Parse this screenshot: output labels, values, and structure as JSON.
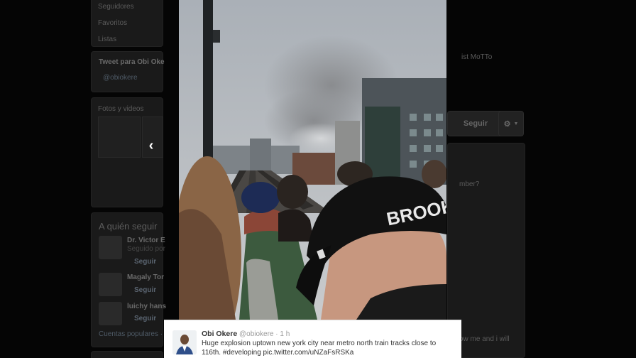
{
  "sidebar_nav": {
    "items": [
      "Seguidores",
      "Favoritos",
      "Listas"
    ]
  },
  "tweet_to": {
    "title": "Tweet para Obi Oke",
    "placeholder": "@obiokere"
  },
  "media": {
    "title": "Fotos y videos"
  },
  "who_to_follow": {
    "title": "A quién seguir",
    "users": [
      {
        "name": "Dr. Victor E",
        "sub": "Seguido por",
        "follow": "Seguir"
      },
      {
        "name": "Magaly Tor",
        "sub": "",
        "follow": "Seguir"
      },
      {
        "name": "luichy hans",
        "sub": "",
        "follow": "Seguir"
      }
    ],
    "footer": "Cuentas populares · En"
  },
  "profile": {
    "bio_fragment": "ist MoTTo",
    "follow_label": "Seguir",
    "gear": "⚙"
  },
  "right_column": {
    "lines": [
      "mber?",
      "",
      "ow me and i will"
    ]
  },
  "lightbox": {
    "prev_label": "‹",
    "photo_text": {
      "cap_text": "BROOKLYN"
    }
  },
  "tweet": {
    "name": "Obi Okere",
    "handle": "@obiokere",
    "separator": "·",
    "time": "1 h",
    "text_line1": "Huge explosion uptown new york city near  metro north train tracks close to",
    "text_line2": "116th. #developing pic.twitter.com/uNZaFsRSKa"
  },
  "colors": {
    "overlay": "#050505",
    "card_bg": "#ffffff",
    "link": "#2b7bb9"
  }
}
